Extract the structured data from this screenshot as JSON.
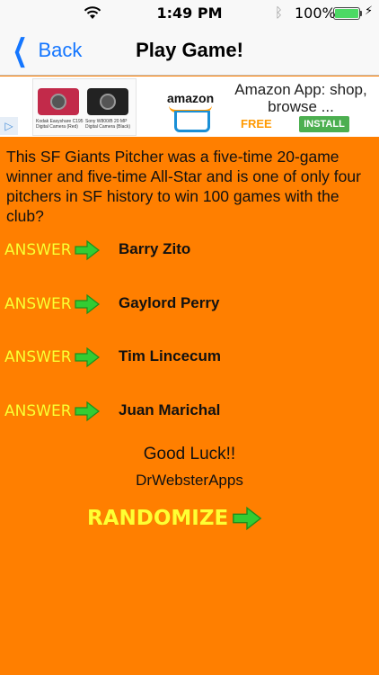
{
  "status_bar": {
    "time": "1:49 PM",
    "battery_percent": "100%",
    "battery_level": 1.0,
    "icons": [
      "wifi-icon",
      "bluetooth-icon",
      "battery-icon",
      "charging-bolt-icon"
    ]
  },
  "nav": {
    "back_label": "Back",
    "title": "Play Game!"
  },
  "ad": {
    "brand": "amazon",
    "title": "Amazon App: shop, browse ...",
    "price": "FREE",
    "install_label": "INSTALL",
    "product_caption_left": "Kodak Easyshare C195 Digital Camera (Red)",
    "product_caption_right": "Sony W800/B 20 MP Digital Camera (Black)",
    "colors": {
      "install": "#4caf50",
      "free": "#ff9900"
    }
  },
  "question": "This SF Giants Pitcher was a five-time 20-game winner and five-time All-Star and is one of only four pitchers in SF history to win 100 games with the club?",
  "answers": [
    {
      "button_label": "ANSWER",
      "text": "Barry Zito"
    },
    {
      "button_label": "ANSWER",
      "text": "Gaylord Perry"
    },
    {
      "button_label": "ANSWER",
      "text": "Tim Lincecum"
    },
    {
      "button_label": "ANSWER",
      "text": "Juan Marichal"
    }
  ],
  "footer": {
    "good_luck": "Good Luck!!",
    "credits": "DrWebsterApps",
    "randomize_label": "RANDOMIZE"
  },
  "colors": {
    "background": "#ff7f00",
    "answer_word": "#ffff33",
    "arrow": "#33cc33",
    "link": "#1476ff"
  }
}
